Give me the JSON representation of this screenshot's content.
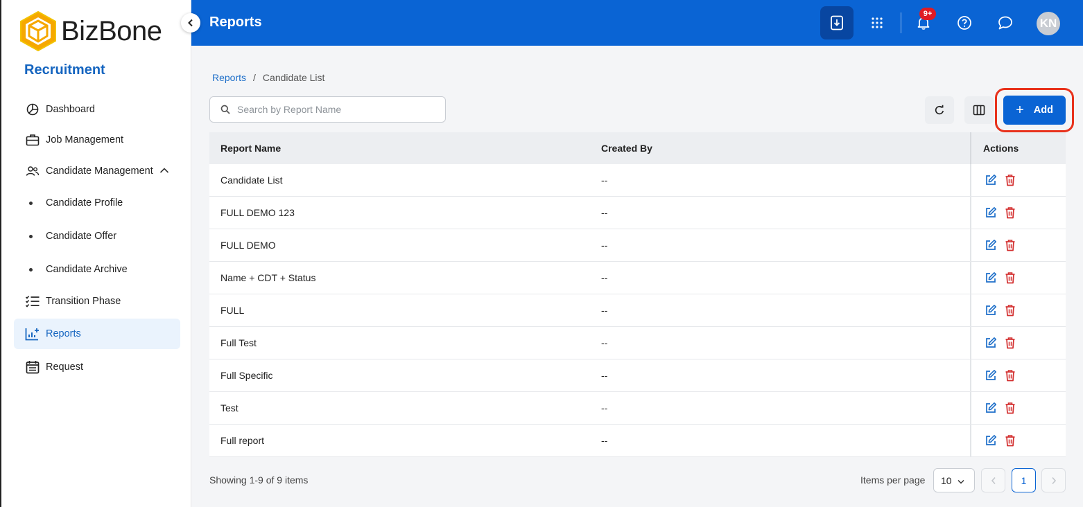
{
  "app": {
    "logo_text": "BizBone",
    "module": "Recruitment"
  },
  "sidebar": {
    "items": [
      {
        "label": "Dashboard",
        "icon": "pie-chart-icon"
      },
      {
        "label": "Job Management",
        "icon": "briefcase-icon"
      },
      {
        "label": "Candidate Management",
        "icon": "users-icon",
        "expanded": true
      },
      {
        "label": "Candidate Profile",
        "sub": true
      },
      {
        "label": "Candidate Offer",
        "sub": true
      },
      {
        "label": "Candidate Archive",
        "sub": true
      },
      {
        "label": "Transition Phase",
        "icon": "checklist-icon"
      },
      {
        "label": "Reports",
        "icon": "report-chart-icon",
        "active": true
      },
      {
        "label": "Request",
        "icon": "calendar-list-icon"
      }
    ]
  },
  "header": {
    "title": "Reports",
    "notification_badge": "9+",
    "avatar_initials": "KN",
    "colors": {
      "bar": "#0a64d4",
      "active_button": "#0846a1"
    }
  },
  "breadcrumb": {
    "parent": "Reports",
    "separator": "/",
    "current": "Candidate List"
  },
  "search": {
    "placeholder": "Search by Report Name",
    "value": ""
  },
  "toolbar": {
    "add_label": "Add"
  },
  "table": {
    "columns": [
      "Report Name",
      "Created By",
      "Actions"
    ],
    "rows": [
      {
        "name": "Candidate List",
        "created_by": "--"
      },
      {
        "name": "FULL DEMO 123",
        "created_by": "--"
      },
      {
        "name": "FULL DEMO",
        "created_by": "--"
      },
      {
        "name": "Name + CDT + Status",
        "created_by": "--"
      },
      {
        "name": "FULL",
        "created_by": "--"
      },
      {
        "name": "Full Test",
        "created_by": "--"
      },
      {
        "name": "Full Specific",
        "created_by": "--"
      },
      {
        "name": "Test",
        "created_by": "--"
      },
      {
        "name": "Full report",
        "created_by": "--"
      }
    ]
  },
  "footer": {
    "showing": "Showing 1-9 of 9 items",
    "items_per_page_label": "Items per page",
    "items_per_page_value": "10",
    "current_page": "1"
  },
  "colors": {
    "primary": "#0a64d4",
    "delete": "#d32f2f",
    "highlight": "#e8321c"
  }
}
